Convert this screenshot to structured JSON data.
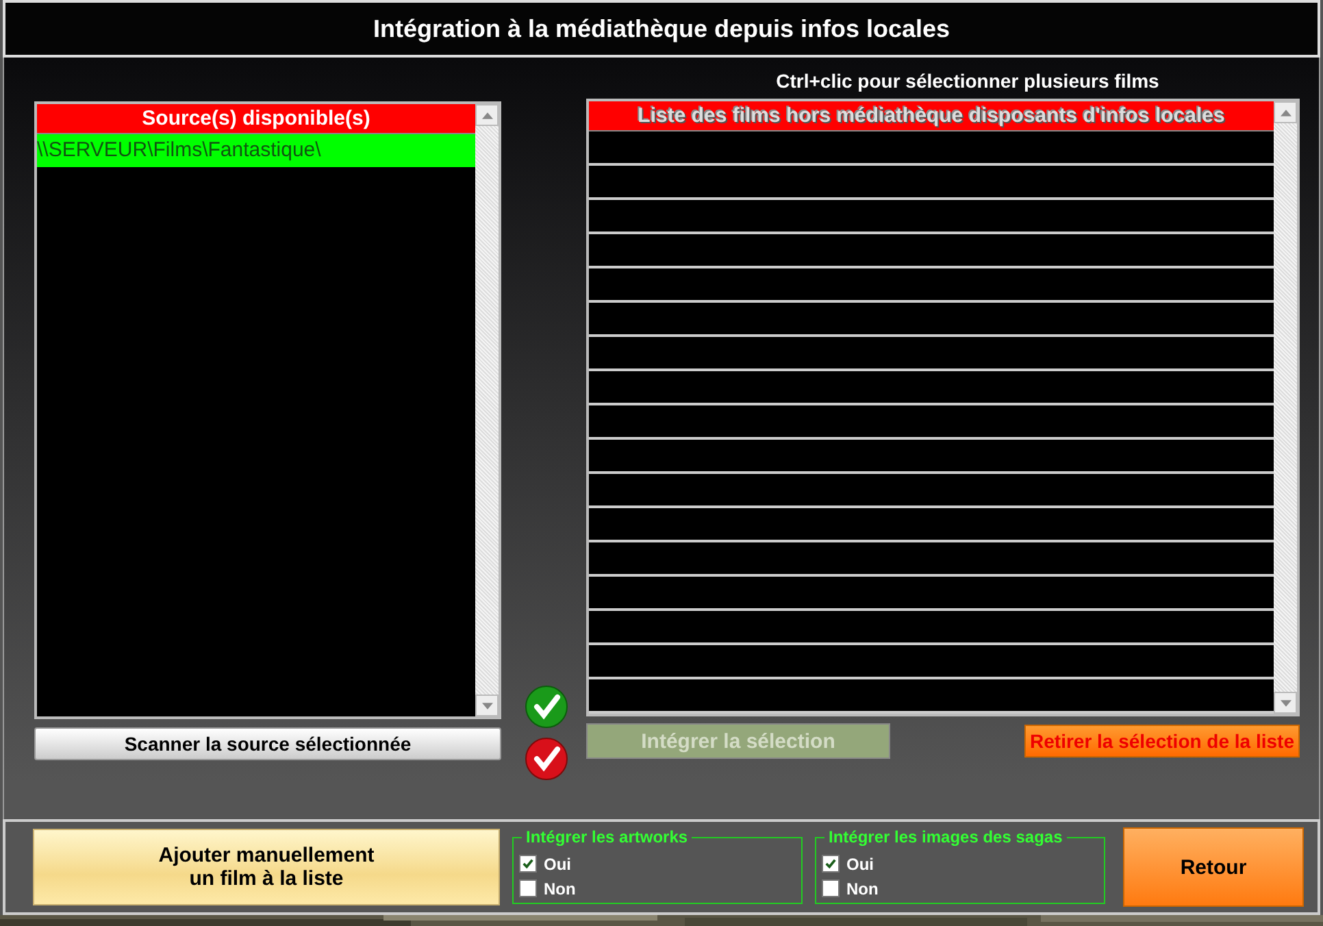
{
  "window": {
    "title": "Intégration à la médiathèque depuis infos locales"
  },
  "sources": {
    "header": "Source(s) disponible(s)",
    "items": [
      {
        "label": "\\\\SERVEUR\\Films\\Fantastique\\",
        "selected": true
      }
    ],
    "scan_button": "Scanner la source sélectionnée"
  },
  "films": {
    "hint": "Ctrl+clic pour sélectionner plusieurs films",
    "header": "Liste des films hors médiathèque disposants d'infos locales",
    "integrate_button": {
      "label": "Intégrer la sélection",
      "disabled": true
    },
    "remove_button": "Retirer la sélection de la liste"
  },
  "bottom": {
    "add_button": "Ajouter manuellement\nun film à la liste",
    "groups": [
      {
        "title": "Intégrer les artworks",
        "options": [
          {
            "label": "Oui",
            "checked": true
          },
          {
            "label": "Non",
            "checked": false
          }
        ]
      },
      {
        "title": "Intégrer les images des sagas",
        "options": [
          {
            "label": "Oui",
            "checked": true
          },
          {
            "label": "Non",
            "checked": false
          }
        ]
      }
    ],
    "back_button": "Retour"
  }
}
